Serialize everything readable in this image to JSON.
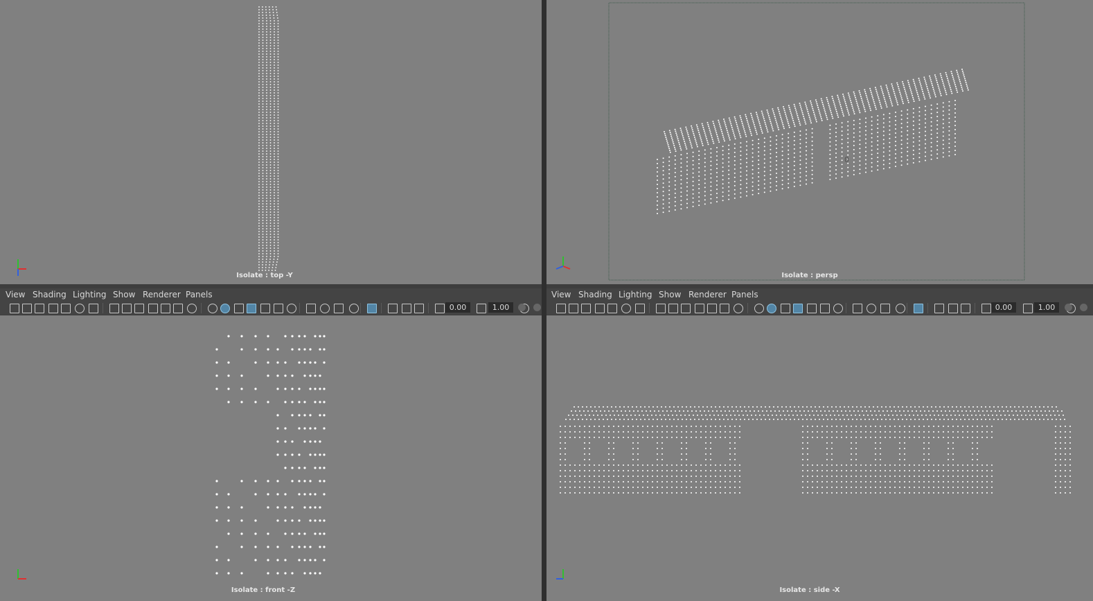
{
  "viewports": {
    "top": {
      "label": "Isolate : top -Y"
    },
    "persp": {
      "label": "Isolate : persp"
    },
    "front": {
      "label": "Isolate : front -Z"
    },
    "side": {
      "label": "Isolate : side -X"
    }
  },
  "menu": {
    "view": "View",
    "shading": "Shading",
    "lighting": "Lighting",
    "show": "Show",
    "renderer": "Renderer",
    "panels": "Panels"
  },
  "toolbar": {
    "exposure": "0.00",
    "gamma": "1.00"
  },
  "colors": {
    "viewport_bg": "#808080",
    "panel_bg": "#444444",
    "points": "#ffffff",
    "active_icon": "#5285a6",
    "axis_x": "#e03030",
    "axis_y": "#30c030",
    "axis_z": "#3060e0"
  },
  "axis_letters": {
    "x": "x",
    "y": "y",
    "z": "z"
  },
  "persp_marker": "0"
}
